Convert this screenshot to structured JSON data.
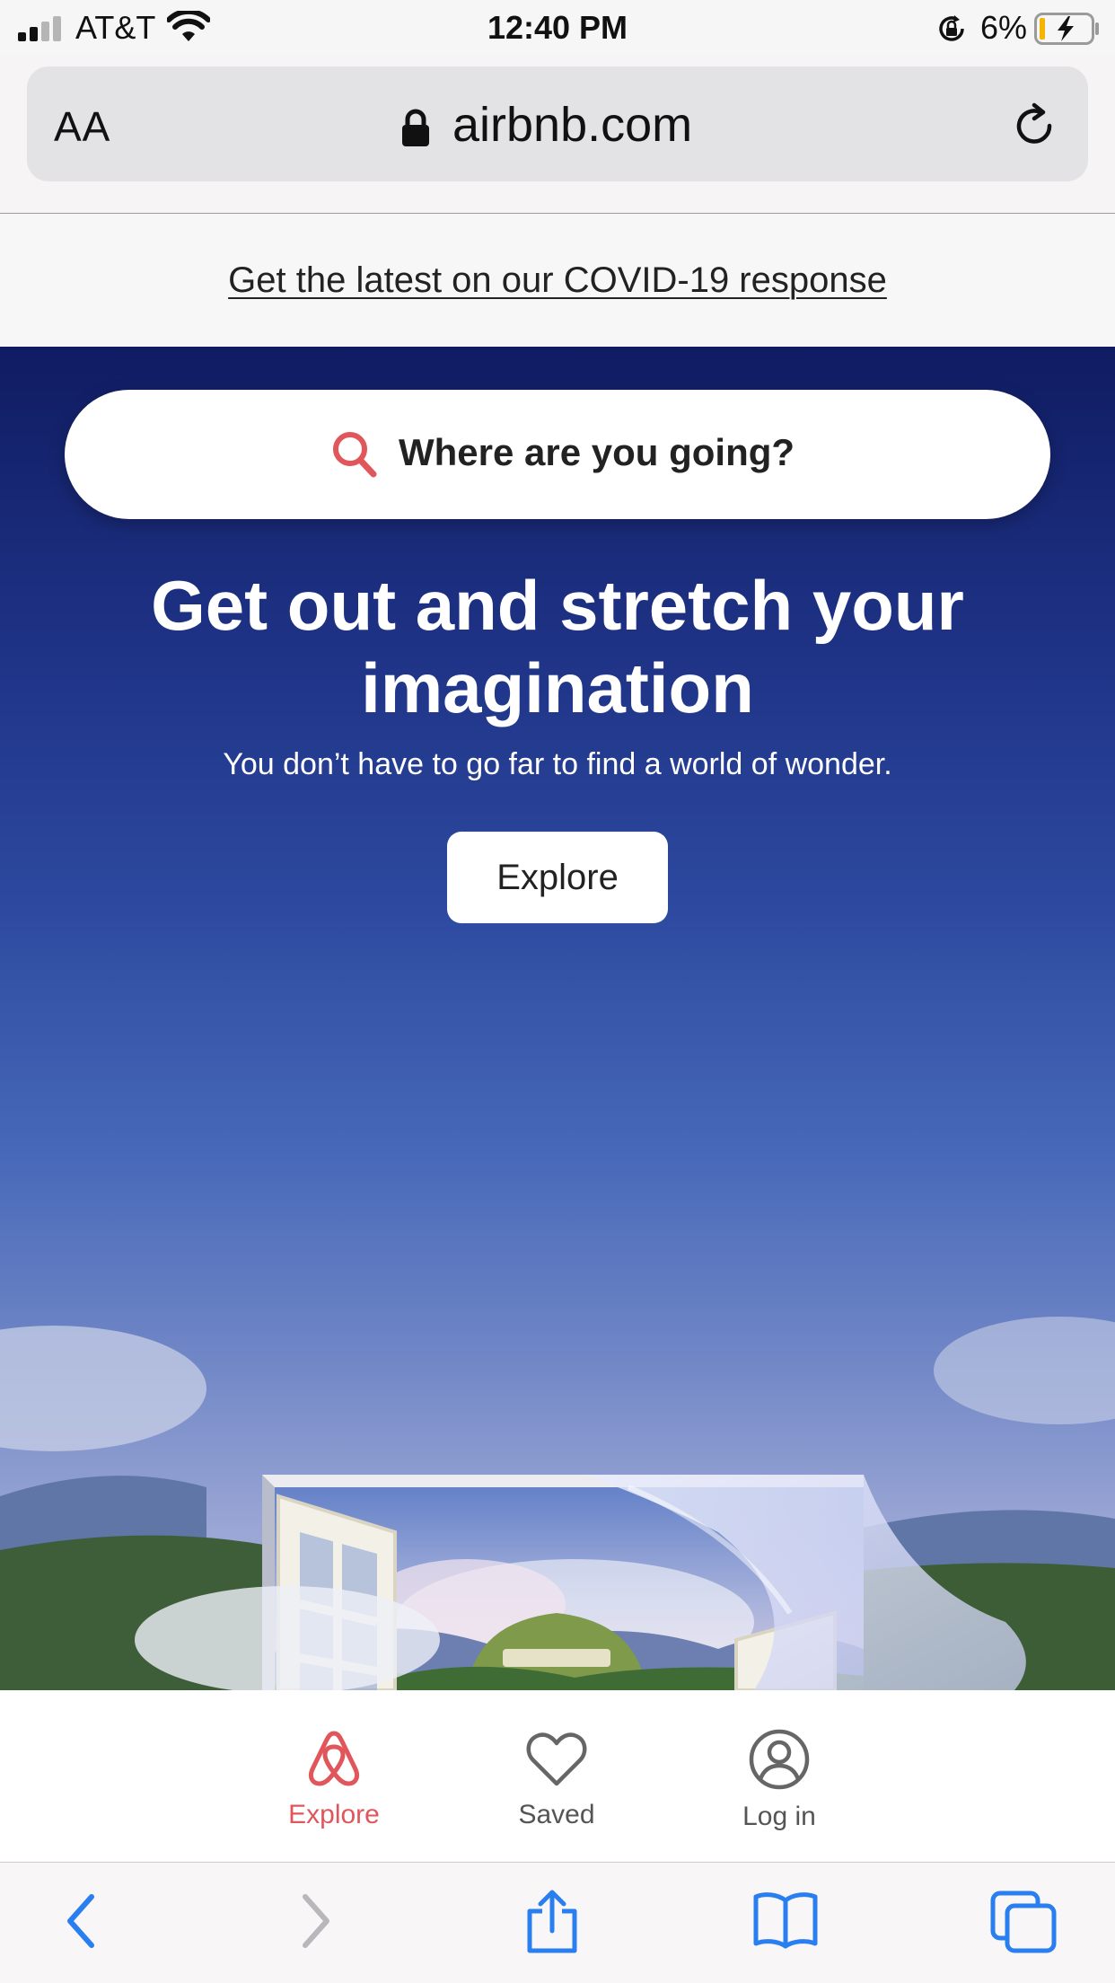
{
  "status_bar": {
    "carrier": "AT&T",
    "time": "12:40 PM",
    "battery_percent": "6%",
    "icons": [
      "signal-icon",
      "wifi-icon",
      "rotation-lock-icon",
      "battery-charging-icon"
    ]
  },
  "url_bar": {
    "text_size_label": "AA",
    "domain": "airbnb.com",
    "icons": [
      "lock-icon",
      "reload-icon"
    ]
  },
  "banner": {
    "link_text": "Get the latest on our COVID-19 response"
  },
  "hero": {
    "search_placeholder": "Where are you going?",
    "title": "Get out and stretch your imagination",
    "subtitle": "You don’t have to go far to find a world of wonder.",
    "cta_label": "Explore"
  },
  "site_nav": {
    "items": [
      {
        "label": "Explore",
        "icon": "airbnb-logo-icon",
        "active": true
      },
      {
        "label": "Saved",
        "icon": "heart-icon",
        "active": false
      },
      {
        "label": "Log in",
        "icon": "user-circle-icon",
        "active": false
      }
    ]
  },
  "colors": {
    "brand": "#e0565b",
    "hero_top": "#101c62",
    "hero_bottom": "#aeb3d6",
    "ios_blue": "#2a7ff0"
  },
  "safari_toolbar": {
    "icons": [
      "back-icon",
      "forward-icon",
      "share-icon",
      "bookmarks-icon",
      "tabs-icon"
    ]
  }
}
